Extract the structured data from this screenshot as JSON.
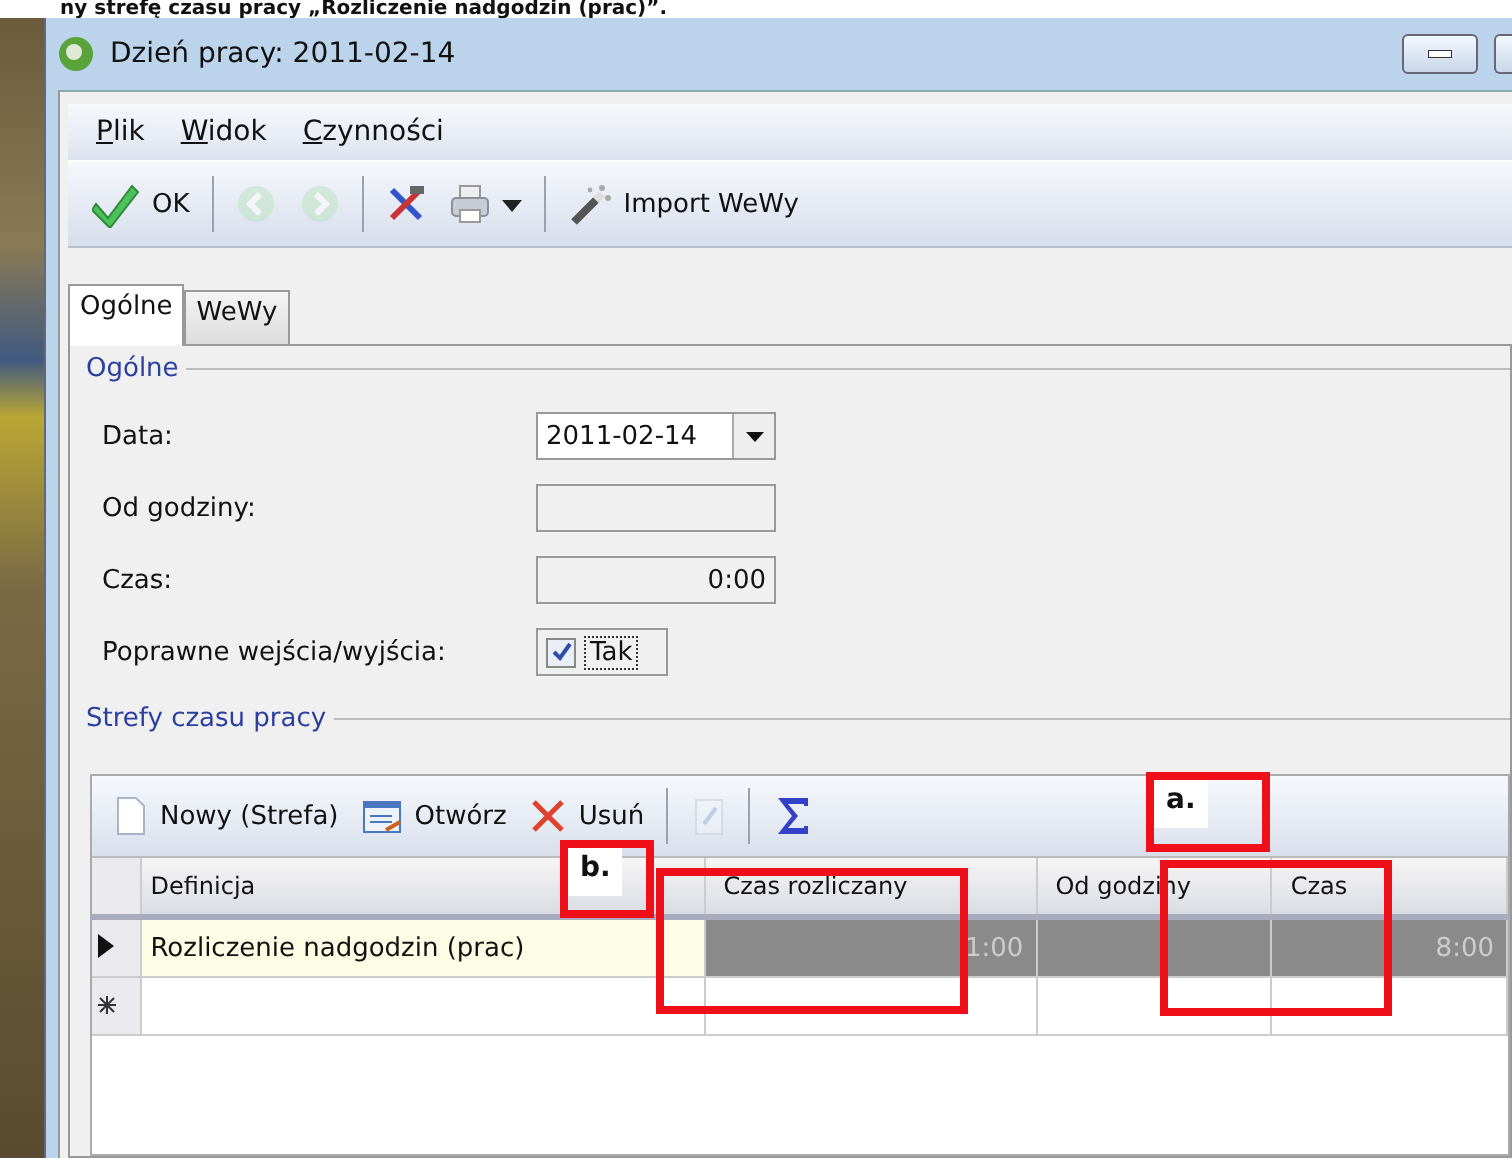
{
  "caption": "ny strefę czasu pracy „Rozliczenie nadgodzin (prac)”.",
  "window": {
    "title": "Dzień pracy: 2011-02-14"
  },
  "menu": [
    {
      "label": "Plik"
    },
    {
      "label": "Widok"
    },
    {
      "label": "Czynności"
    }
  ],
  "toolbar": [
    {
      "kind": "button",
      "label": "OK",
      "disabled": false
    },
    {
      "kind": "separator"
    },
    {
      "kind": "button",
      "disabled": true
    },
    {
      "kind": "button",
      "disabled": true
    },
    {
      "kind": "separator"
    },
    {
      "kind": "button",
      "disabled": false
    },
    {
      "kind": "dropdown",
      "disabled": false
    },
    {
      "kind": "separator"
    },
    {
      "kind": "button",
      "label": "Import WeWy",
      "disabled": false
    }
  ],
  "tabs": [
    {
      "label": "Ogólne",
      "selected": true
    },
    {
      "label": "WeWy",
      "selected": false
    }
  ],
  "general": {
    "title": "Ogólne",
    "fields": [
      {
        "kind": "date",
        "label": "Data:",
        "value": "2011-02-14"
      },
      {
        "kind": "text",
        "label": "Od godziny:"
      },
      {
        "kind": "text",
        "label": "Czas:",
        "value": "0:00"
      },
      {
        "kind": "checkbox",
        "label": "Poprawne wejścia/wyjścia:",
        "checked": true,
        "text": "Tak"
      }
    ]
  },
  "zones": {
    "title": "Strefy czasu pracy",
    "toolbar": [
      {
        "kind": "button",
        "label": "Nowy (Strefa)",
        "disabled": false
      },
      {
        "kind": "button",
        "label": "Otwórz",
        "disabled": false
      },
      {
        "kind": "button",
        "label": "Usuń",
        "disabled": false
      },
      {
        "kind": "separator"
      },
      {
        "kind": "button",
        "disabled": true
      },
      {
        "kind": "separator"
      },
      {
        "kind": "button",
        "disabled": false
      }
    ],
    "columns": [
      "Definicja",
      "Czas rozliczany",
      "Od godziny",
      "Czas"
    ],
    "rows": [
      {
        "definition": "Rozliczenie nadgodzin (prac)",
        "settled_time": "1:00",
        "time": "8:00",
        "selected": true
      }
    ]
  },
  "annotations": [
    {
      "label": "a."
    },
    {
      "label": "b."
    }
  ]
}
